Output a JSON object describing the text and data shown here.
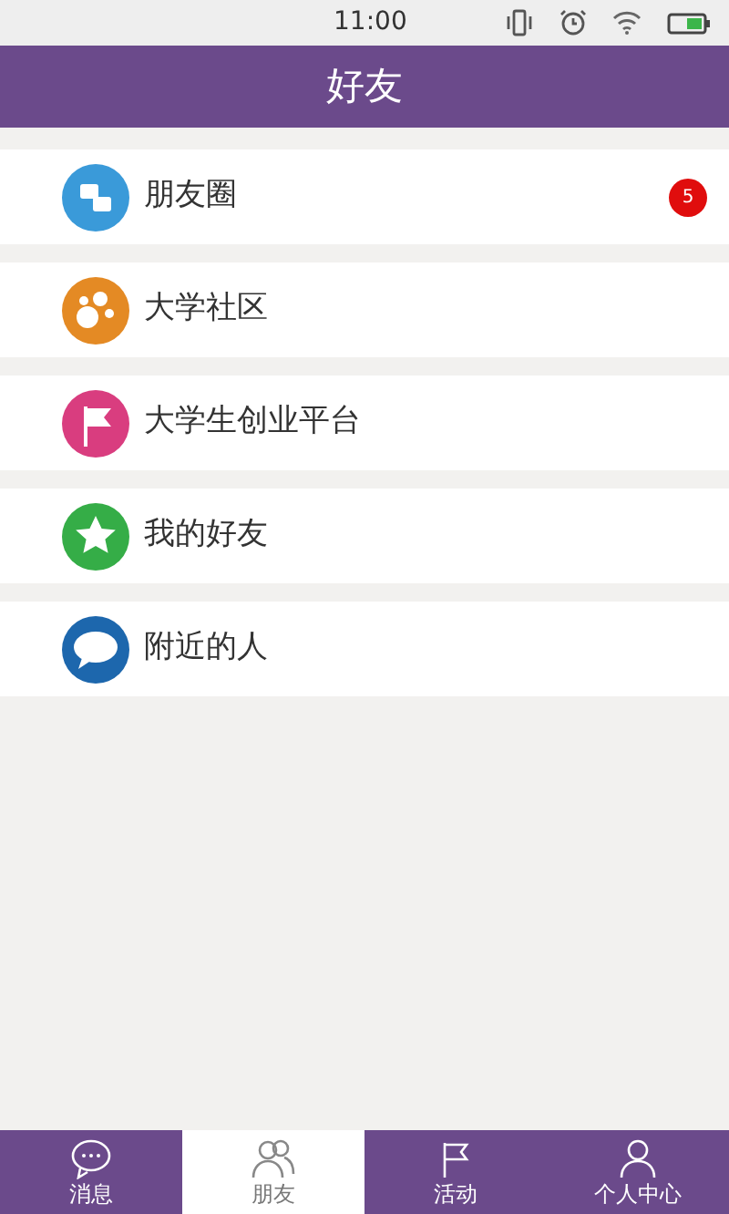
{
  "status_bar": {
    "time": "11:00"
  },
  "header": {
    "title": "好友"
  },
  "items": [
    {
      "kind": "moments",
      "label": "朋友圈",
      "badge": "5"
    },
    {
      "kind": "community",
      "label": "大学社区"
    },
    {
      "kind": "startup",
      "label": "大学生创业平台"
    },
    {
      "kind": "friends",
      "label": "我的好友"
    },
    {
      "kind": "nearby",
      "label": "附近的人"
    }
  ],
  "tabs": [
    {
      "kind": "messages",
      "label": "消息",
      "selected": false
    },
    {
      "kind": "friends",
      "label": "朋友",
      "selected": true
    },
    {
      "kind": "activity",
      "label": "活动",
      "selected": false
    },
    {
      "kind": "profile",
      "label": "个人中心",
      "selected": false
    }
  ]
}
